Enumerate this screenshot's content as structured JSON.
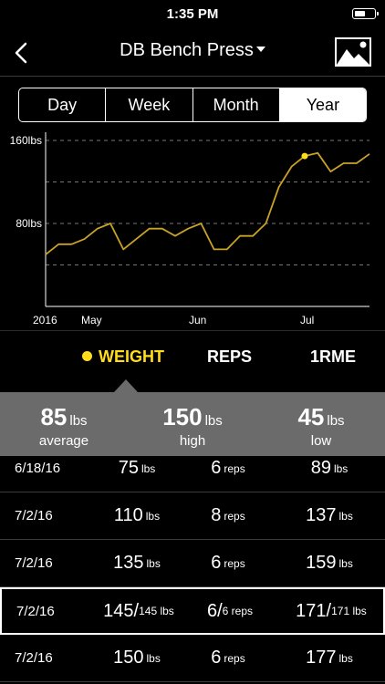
{
  "status": {
    "time": "1:35 PM",
    "battery_level": 0.55
  },
  "nav": {
    "title": "DB Bench Press",
    "back_icon": "chevron-left-icon",
    "image_icon": "image-icon"
  },
  "segments": [
    {
      "label": "Day",
      "active": false
    },
    {
      "label": "Week",
      "active": false
    },
    {
      "label": "Month",
      "active": false
    },
    {
      "label": "Year",
      "active": true
    }
  ],
  "chart_data": {
    "type": "line",
    "x_ticks": [
      "2016",
      "May",
      "Jun",
      "Jul"
    ],
    "y_ticks": [
      "160lbs",
      "80lbs"
    ],
    "ylim": [
      0,
      160
    ],
    "gridlines_y": [
      40,
      80,
      120,
      160
    ],
    "line_color": "#c9a227",
    "highlight_color": "#ffdd1a",
    "values": [
      50,
      60,
      60,
      65,
      75,
      80,
      55,
      65,
      75,
      75,
      68,
      75,
      80,
      55,
      55,
      68,
      68,
      80,
      115,
      135,
      145,
      148,
      130,
      138,
      138,
      147
    ],
    "highlight_index": 20
  },
  "metrics": {
    "weight": "WEIGHT",
    "reps": "REPS",
    "rme": "1RME",
    "active_color": "#ffdd1a"
  },
  "summary": {
    "average": {
      "value": "85",
      "unit": "lbs",
      "label": "average"
    },
    "high": {
      "value": "150",
      "unit": "lbs",
      "label": "high"
    },
    "low": {
      "value": "45",
      "unit": "lbs",
      "label": "low"
    }
  },
  "rows": [
    {
      "date": "6/18/16",
      "weight": "75",
      "weight_unit": "lbs",
      "reps": "6",
      "reps_unit": "reps",
      "rme": "89",
      "rme_unit": "lbs",
      "selected": false
    },
    {
      "date": "7/2/16",
      "weight": "110",
      "weight_unit": "lbs",
      "reps": "8",
      "reps_unit": "reps",
      "rme": "137",
      "rme_unit": "lbs",
      "selected": false
    },
    {
      "date": "7/2/16",
      "weight": "135",
      "weight_unit": "lbs",
      "reps": "6",
      "reps_unit": "reps",
      "rme": "159",
      "rme_unit": "lbs",
      "selected": false
    },
    {
      "date": "7/2/16",
      "weight": "145/",
      "weight_unit": "145 lbs",
      "reps": "6/",
      "reps_unit": "6 reps",
      "rme": "171/",
      "rme_unit": "171 lbs",
      "selected": true
    },
    {
      "date": "7/2/16",
      "weight": "150",
      "weight_unit": "lbs",
      "reps": "6",
      "reps_unit": "reps",
      "rme": "177",
      "rme_unit": "lbs",
      "selected": false
    }
  ]
}
